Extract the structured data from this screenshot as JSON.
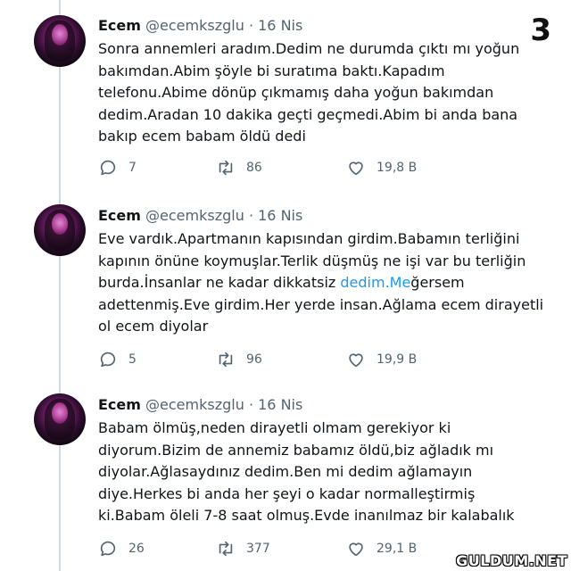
{
  "page_number": "3",
  "watermark": "GULDUM.NET",
  "tweets": [
    {
      "name": "Ecem",
      "handle": "@ecemkszglu",
      "separator": "·",
      "date": "16 Nis",
      "text_before": "Sonra annemleri aradım.Dedim ne durumda çıktı mı yoğun bakımdan.Abim şöyle bi suratıma baktı.Kapadım telefonu.Abime dönüp çıkmamış daha yoğun bakımdan dedim.Aradan 10 dakika geçti geçmedi.Abim bi anda bana bakıp ecem babam öldü dedi",
      "link": "",
      "text_after": "",
      "replies": "7",
      "retweets": "86",
      "likes": "19,8 B"
    },
    {
      "name": "Ecem",
      "handle": "@ecemkszglu",
      "separator": "·",
      "date": "16 Nis",
      "text_before": "Eve vardık.Apartmanın kapısından girdim.Babamın terliğini kapının önüne koymuşlar.Terlik düşmüş ne işi var bu terliğin burda.İnsanlar ne kadar dikkatsiz ",
      "link": "dedim.Me",
      "text_after": "ğersem adettenmiş.Eve girdim.Her yerde insan.Ağlama ecem dirayetli ol ecem diyolar",
      "replies": "5",
      "retweets": "96",
      "likes": "19,9 B"
    },
    {
      "name": "Ecem",
      "handle": "@ecemkszglu",
      "separator": "·",
      "date": "16 Nis",
      "text_before": "Babam ölmüş,neden dirayetli olmam gerekiyor ki diyorum.Bizim de annemiz babamız öldü,biz ağladık mı diyolar.Ağlasaydınız dedim.Ben mi dedim ağlamayın diye.Herkes bi anda her şeyi o kadar normalleştirmiş ki.Babam öleli 7-8 saat olmuş.Evde inanılmaz bir kalabalık",
      "link": "",
      "text_after": "",
      "replies": "26",
      "retweets": "377",
      "likes": "29,1 B"
    }
  ],
  "icons": {
    "reply": "reply-icon",
    "retweet": "retweet-icon",
    "like": "like-icon"
  },
  "colors": {
    "text": "#0f1419",
    "muted": "#536471",
    "link": "#1d9bf0",
    "thread_line": "#cfd9de"
  }
}
